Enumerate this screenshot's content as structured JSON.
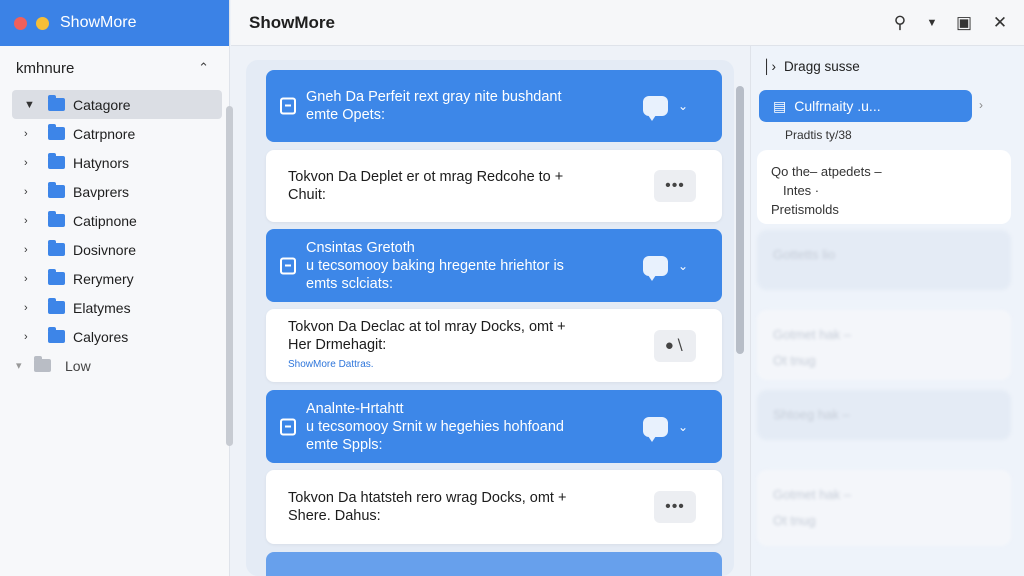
{
  "app": {
    "name": "ShowMore"
  },
  "header": {
    "title": "ShowMore"
  },
  "sidebar": {
    "section": "kmhnure",
    "items": [
      {
        "label": "Catagore",
        "selected": true,
        "expanded": true
      },
      {
        "label": "Catrpnore"
      },
      {
        "label": "Hatynors"
      },
      {
        "label": "Bavprers"
      },
      {
        "label": "Catipnone"
      },
      {
        "label": "Dosivnore"
      },
      {
        "label": "Rerymery"
      },
      {
        "label": "Elatymes"
      },
      {
        "label": "Calyores"
      }
    ],
    "low_label": "Low"
  },
  "cards": [
    {
      "style": "blue",
      "line1": "Gneh Da Perfeit  rext gray nite bushdant",
      "line2": "emte Opets:"
    },
    {
      "style": "white",
      "line1": "Tokvon Da Deplet  er ot mrag Redcohe to +",
      "line2": "Chuit:"
    },
    {
      "style": "blue",
      "line1": "Cnsintas Gretoth",
      "line2": "u tecsomooy  baking hregente hriehtor is",
      "line3": "emts sclciats:"
    },
    {
      "style": "white",
      "line1": "Tokvon Da Declac  at tol mray Docks, omt +",
      "line2": "Her Drmehagit:",
      "link": "ShowMore Dattras."
    },
    {
      "style": "blue",
      "line1": "Analnte-Hrtahtt",
      "line2": "u tecsomooy  Srnit w hegehies hohfoand",
      "line3": "emte Sppls:"
    },
    {
      "style": "white",
      "line1": "Tokvon Da htatsteh  rero wrag Docks, omt +",
      "line2": "Shere. Dahus:"
    }
  ],
  "right_panel": {
    "header": "Dragg susse",
    "button": "Culfrnaity .u...",
    "subtitle": "Pradtis ty/38",
    "card": {
      "line1": "Qo  the– atpedets –",
      "line2": "Intes ·",
      "line3": "Pretismolds"
    },
    "ghosts": [
      "Gottetts lio",
      "Gotmet hak –",
      "Ot tnug",
      "Shtoeg hak –",
      "Gotmet hak –",
      "Ot tnug"
    ]
  }
}
